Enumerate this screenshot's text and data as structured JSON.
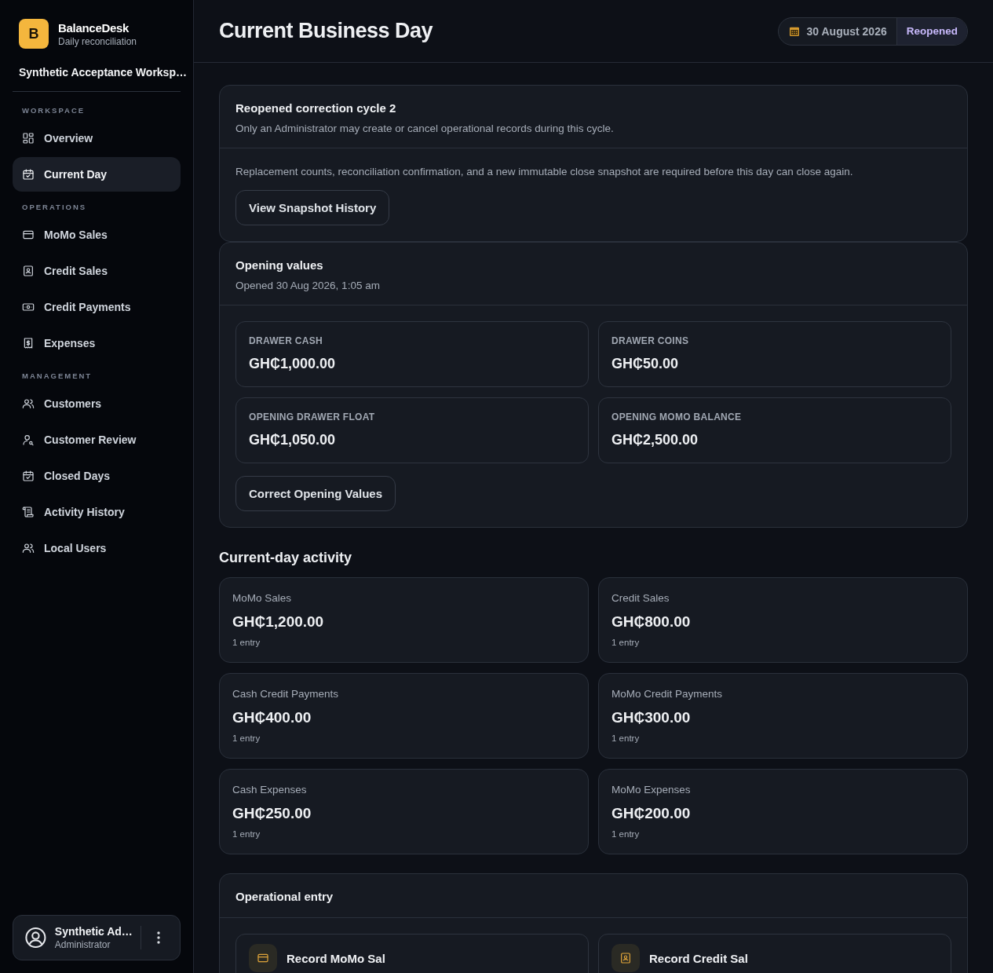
{
  "sidebar": {
    "brand": {
      "logo_letter": "B",
      "name": "BalanceDesk",
      "tagline": "Daily reconciliation"
    },
    "workspace": "Synthetic Acceptance Worksp…",
    "sections": [
      {
        "title": "WORKSPACE",
        "items": [
          {
            "label": "Overview",
            "kind": "grid",
            "selected": false
          },
          {
            "label": "Current Day",
            "kind": "calendar",
            "selected": true
          }
        ]
      },
      {
        "title": "OPERATIONS",
        "items": [
          {
            "label": "MoMo Sales",
            "kind": "card",
            "selected": false
          },
          {
            "label": "Credit Sales",
            "kind": "contact",
            "selected": false
          },
          {
            "label": "Credit Payments",
            "kind": "banknote",
            "selected": false
          },
          {
            "label": "Expenses",
            "kind": "receipt",
            "selected": false
          }
        ]
      },
      {
        "title": "MANAGEMENT",
        "items": [
          {
            "label": "Customers",
            "kind": "users",
            "selected": false
          },
          {
            "label": "Customer Review",
            "kind": "review",
            "selected": false
          },
          {
            "label": "Closed Days",
            "kind": "calendar",
            "selected": false
          },
          {
            "label": "Activity History",
            "kind": "scroll",
            "selected": false
          },
          {
            "label": "Local Users",
            "kind": "users",
            "selected": false
          }
        ]
      }
    ],
    "user": {
      "name": "Synthetic Ad…",
      "role": "Administrator"
    }
  },
  "header": {
    "title": "Current Business Day",
    "date": "30 August 2026",
    "status": "Reopened"
  },
  "notice": {
    "title": "Reopened correction cycle 2",
    "subtitle": "Only an Administrator may create or cancel operational records during this cycle.",
    "body": "Replacement counts, reconciliation confirmation, and a new immutable close snapshot are required before this day can close again.",
    "button": "View Snapshot History"
  },
  "opening": {
    "title": "Opening values",
    "subtitle": "Opened 30 Aug 2026, 1:05 am",
    "values": [
      {
        "label": "DRAWER CASH",
        "amount": "GH₵1,000.00"
      },
      {
        "label": "DRAWER COINS",
        "amount": "GH₵50.00"
      },
      {
        "label": "OPENING DRAWER FLOAT",
        "amount": "GH₵1,050.00"
      },
      {
        "label": "OPENING MOMO BALANCE",
        "amount": "GH₵2,500.00"
      }
    ],
    "button": "Correct Opening Values"
  },
  "activity": {
    "title": "Current-day activity",
    "items": [
      {
        "label": "MoMo Sales",
        "amount": "GH₵1,200.00",
        "count": "1 entry"
      },
      {
        "label": "Credit Sales",
        "amount": "GH₵800.00",
        "count": "1 entry"
      },
      {
        "label": "Cash Credit Payments",
        "amount": "GH₵400.00",
        "count": "1 entry"
      },
      {
        "label": "MoMo Credit Payments",
        "amount": "GH₵300.00",
        "count": "1 entry"
      },
      {
        "label": "Cash Expenses",
        "amount": "GH₵250.00",
        "count": "1 entry"
      },
      {
        "label": "MoMo Expenses",
        "amount": "GH₵200.00",
        "count": "1 entry"
      }
    ]
  },
  "operational_entry": {
    "title": "Operational entry",
    "actions": [
      {
        "label": "Record MoMo Sal",
        "kind": "card"
      },
      {
        "label": "Record Credit Sal",
        "kind": "contact"
      }
    ]
  }
}
